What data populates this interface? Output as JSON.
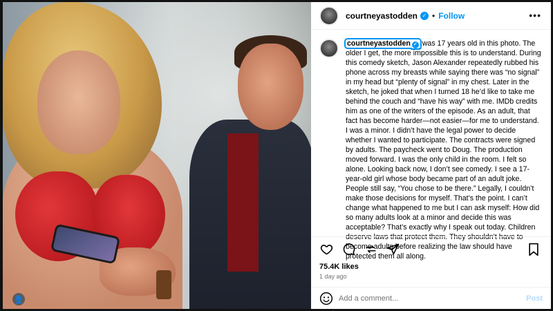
{
  "post": {
    "username": "courtneyastodden",
    "follow_label": "Follow",
    "dot": "•",
    "more_label": "•••",
    "caption_user": "courtneyastodden",
    "caption_text": " was 17 years old in this photo. The older I get, the more impossible this is to understand. During this comedy sketch, Jason Alexander repeatedly rubbed his phone across my breasts while saying there was “no signal” in my head but “plenty of signal” in my chest. Later in the sketch, he joked that when I turned 18 he’d like to take me behind the couch and “have his way” with me. IMDb credits him as one of the writers of the episode. As an adult, that fact has become harder—not easier—for me to understand. I was a minor. I didn’t have the legal power to decide whether I wanted to participate. The contracts were signed by adults. The paycheck went to Doug. The production moved forward. I was the only child in the room. I felt so alone. Looking back now, I don’t see comedy. I see a 17-year-old girl whose body became part of an adult joke. People still say, “You chose to be there.” Legally, I couldn’t make those decisions for myself. That’s the point. I can’t change what happened to me but I can ask myself: How did so many adults look at a minor and decide this was acceptable? That’s exactly why I speak out today. Children deserve laws that protect them. They shouldn’t have to become adults before realizing the law should have protected them all along.",
    "likes": "75.4K likes",
    "time": "1 day ago",
    "comment_placeholder": "Add a comment...",
    "post_label": "Post"
  },
  "icons": {
    "verified": "✓",
    "user": "👤"
  },
  "colors": {
    "accent": "#0095f6",
    "post_disabled": "#b3dbff",
    "muted": "#737373"
  }
}
